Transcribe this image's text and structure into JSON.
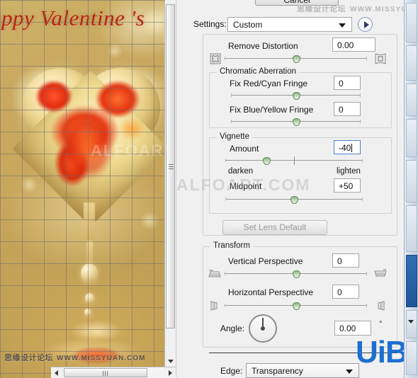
{
  "dialog": {
    "cancel_label": "Cancel",
    "settings_label": "Settings:",
    "settings_value": "Custom",
    "settings_menu_icon": "play-triangle-icon",
    "settings_caret_icon": "chevron-down-icon"
  },
  "remove_distortion": {
    "label": "Remove Distortion",
    "value": "0.00",
    "slider_percent": 50,
    "left_icon": "pincushion-distortion-icon",
    "right_icon": "barrel-distortion-icon"
  },
  "chromatic_aberration": {
    "title": "Chromatic Aberration",
    "rows": [
      {
        "label": "Fix Red/Cyan Fringe",
        "value": "0",
        "slider_percent": 50
      },
      {
        "label": "Fix Blue/Yellow Fringe",
        "value": "0",
        "slider_percent": 50
      }
    ]
  },
  "vignette": {
    "title": "Vignette",
    "amount": {
      "label": "Amount",
      "value": "-40",
      "slider_percent": 30,
      "tick_percent": 50,
      "left_hint": "darken",
      "right_hint": "lighten"
    },
    "midpoint": {
      "label": "Midpoint",
      "value": "+50",
      "slider_percent": 50
    }
  },
  "set_lens_default": {
    "label": "Set Lens Default",
    "enabled": false
  },
  "transform": {
    "title": "Transform",
    "rows": [
      {
        "label": "Vertical Perspective",
        "value": "0",
        "slider_percent": 50,
        "left_icon": "perspective-top-icon",
        "right_icon": "perspective-bottom-icon"
      },
      {
        "label": "Horizontal Perspective",
        "value": "0",
        "slider_percent": 50,
        "left_icon": "perspective-left-icon",
        "right_icon": "perspective-right-icon"
      }
    ],
    "angle": {
      "label": "Angle:",
      "value": "0.00",
      "degree_symbol": "°",
      "dial_icon": "angle-dial-icon"
    }
  },
  "edge": {
    "label": "Edge:",
    "value": "Transparency",
    "caret_icon": "chevron-down-icon"
  },
  "preview": {
    "artwork_text": "appy Valentine 's",
    "vertical_scrollbar": "preview-vertical-scrollbar",
    "horizontal_scrollbar": "preview-horizontal-scrollbar"
  },
  "watermarks": {
    "missyuan_cn": "思缘设计论坛",
    "missyuan_url": "WWW.MISSYUAN.COM",
    "alfoart": "ALFOART.COM",
    "uibq": "UiBQ.CoM"
  },
  "colors": {
    "panel_bg": "#f0f0f0",
    "slider_thumb_green": "#8fb584",
    "focus_blue": "#4f7fc4",
    "uibq_blue": "#1d6fd0",
    "valentine_red": "#b2240d"
  }
}
